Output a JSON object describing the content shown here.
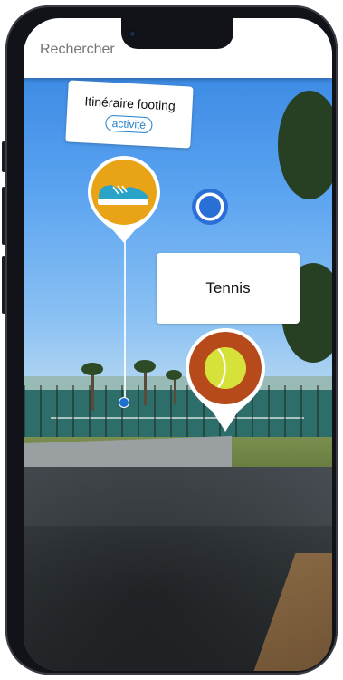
{
  "search": {
    "placeholder": "Rechercher"
  },
  "pois": [
    {
      "title": "Itinéraire footing",
      "badge": "activité",
      "icon": "running-shoe-icon",
      "pin_color": "#e8a317"
    },
    {
      "title": "Tennis",
      "icon": "tennis-ball-icon",
      "pin_color": "#b64a1a",
      "ball_color": "#d6e23a"
    }
  ],
  "colors": {
    "accent": "#1f7fc6",
    "location": "#2a6fd6"
  }
}
